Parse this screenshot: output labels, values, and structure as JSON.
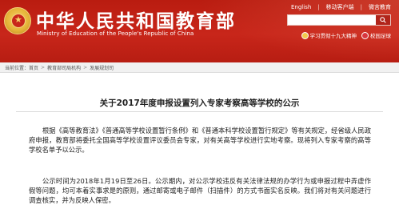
{
  "header": {
    "title": "中华人民共和国教育部",
    "subtitle": "Ministry of Education of the People's Republic of China",
    "top_links": [
      "English",
      "移动客户端",
      "微言教育"
    ],
    "badges": [
      "学习贯彻十九大精神",
      "校园足球"
    ],
    "colors": {
      "brand_red": "#c8261a",
      "emblem_gold": "#e6b53a"
    }
  },
  "breadcrumb": [
    "当前位置",
    "首页",
    "教育部司局机构",
    "发展规划司"
  ],
  "article": {
    "title": "关于2017年度申报设置列入专家考察高等学校的公示",
    "paragraphs": [
      "根据《高等教育法》《普通高等学校设置暂行条例》和《普通本科学校设置暂行规定》等有关规定，经省级人民政府申报，教育部将委托全国高等学校设置评议委员会专家，对有关高等学校进行实地考察。现将列入专家考察的高等学校名单予以公示。",
      "公示时间为2018年1月19日至26日。公示期内，对公示学校违反有关法律法规的办学行为或申报过程中弄虚作假等问题，均可本着实事求是的原则，通过邮寄或电子邮件（扫描件）的方式书面实名反映。我们将对有关问题进行调查核实，并为反映人保密。"
    ]
  }
}
